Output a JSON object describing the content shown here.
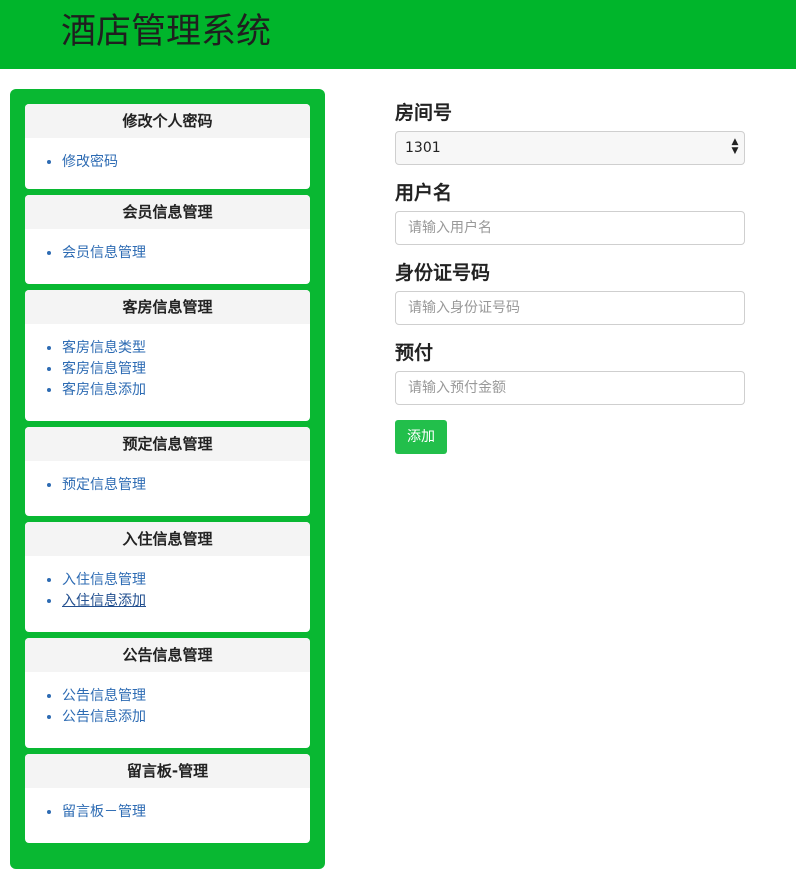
{
  "header": {
    "title": "酒店管理系统"
  },
  "sidebar": {
    "panels": [
      {
        "title": "修改个人密码",
        "items": [
          "修改密码"
        ]
      },
      {
        "title": "会员信息管理",
        "items": [
          "会员信息管理"
        ]
      },
      {
        "title": "客房信息管理",
        "items": [
          "客房信息类型",
          "客房信息管理",
          "客房信息添加"
        ]
      },
      {
        "title": "预定信息管理",
        "items": [
          "预定信息管理"
        ]
      },
      {
        "title": "入住信息管理",
        "items": [
          "入住信息管理",
          "入住信息添加"
        ]
      },
      {
        "title": "公告信息管理",
        "items": [
          "公告信息管理",
          "公告信息添加"
        ]
      },
      {
        "title": "留言板-管理",
        "items": [
          "留言板－管理"
        ]
      }
    ]
  },
  "form": {
    "room_label": "房间号",
    "room_value": "1301",
    "username_label": "用户名",
    "username_placeholder": "请输入用户名",
    "idcard_label": "身份证号码",
    "idcard_placeholder": "请输入身份证号码",
    "prepay_label": "预付",
    "prepay_placeholder": "请输入预付金额",
    "submit_label": "添加"
  },
  "colors": {
    "accent": "#00b52b",
    "sidebar": "#09b832",
    "link": "#2d6bb3",
    "button": "#22bf4b"
  }
}
